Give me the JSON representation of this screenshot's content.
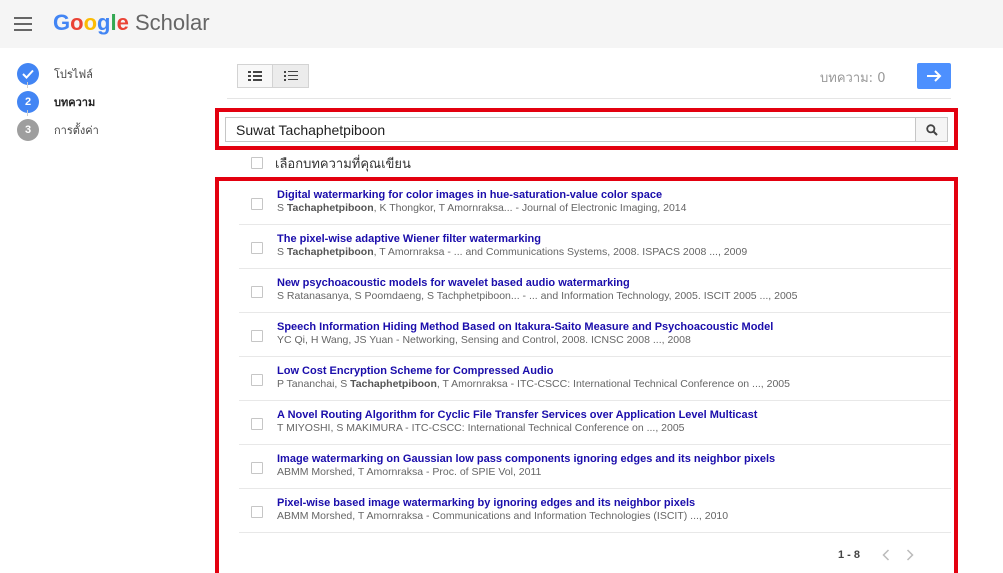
{
  "header": {
    "logo_letters": [
      "G",
      "o",
      "o",
      "g",
      "l",
      "e"
    ],
    "logo_suffix": "Scholar"
  },
  "steps": [
    {
      "number": "",
      "label": "โปรไฟล์",
      "state": "done"
    },
    {
      "number": "2",
      "label": "บทความ",
      "state": "current"
    },
    {
      "number": "3",
      "label": "การตั้งค่า",
      "state": "pending"
    }
  ],
  "toolbar": {
    "article_count_label": "บทความ: 0"
  },
  "search": {
    "value": "Suwat Tachaphetpiboon"
  },
  "select_all_label": "เลือกบทความที่คุณเขียน",
  "results": [
    {
      "title": "Digital watermarking for color images in hue-saturation-value color space",
      "authors_pre": "S ",
      "authors_bold": "Tachaphetpiboon",
      "authors_post": ", K Thongkor, T Amornraksa... - Journal of Electronic Imaging, 2014"
    },
    {
      "title": "The pixel-wise adaptive Wiener filter watermarking",
      "authors_pre": "S ",
      "authors_bold": "Tachaphetpiboon",
      "authors_post": ", T Amornraksa - ... and Communications Systems, 2008. ISPACS 2008 ..., 2009"
    },
    {
      "title": "New psychoacoustic models for wavelet based audio watermarking",
      "authors_pre": "S Ratanasanya, S Poomdaeng, S Tachphetpiboon... - ... and Information Technology, 2005. ISCIT 2005 ..., 2005",
      "authors_bold": "",
      "authors_post": ""
    },
    {
      "title": "Speech Information Hiding Method Based on Itakura-Saito Measure and Psychoacoustic Model",
      "authors_pre": "YC Qi, H Wang, JS Yuan - Networking, Sensing and Control, 2008. ICNSC 2008 ..., 2008",
      "authors_bold": "",
      "authors_post": ""
    },
    {
      "title": "Low Cost Encryption Scheme for Compressed Audio",
      "authors_pre": "P Tananchai, S ",
      "authors_bold": "Tachaphetpiboon",
      "authors_post": ", T Amornraksa - ITC-CSCC: International Technical Conference on ..., 2005"
    },
    {
      "title": "A Novel Routing Algorithm for Cyclic File Transfer Services over Application Level Multicast",
      "authors_pre": "T MIYOSHI, S MAKIMURA - ITC-CSCC: International Technical Conference on ..., 2005",
      "authors_bold": "",
      "authors_post": ""
    },
    {
      "title": "Image watermarking on Gaussian low pass components ignoring edges and its neighbor pixels",
      "authors_pre": "ABMM Morshed, T Amornraksa - Proc. of SPIE Vol, 2011",
      "authors_bold": "",
      "authors_post": ""
    },
    {
      "title": "Pixel-wise based image watermarking by ignoring edges and its neighbor pixels",
      "authors_pre": "ABMM Morshed, T Amornraksa - Communications and Information Technologies (ISCIT) ..., 2010",
      "authors_bold": "",
      "authors_post": ""
    }
  ],
  "pagination": {
    "range": "1 - 8"
  },
  "icons": {
    "menu": "hamburger-menu-icon",
    "next": "arrow-right-icon",
    "search": "magnifier-icon",
    "prev_page": "chevron-left-icon",
    "next_page": "chevron-right-icon",
    "done_step": "checkmark-icon"
  },
  "colors": {
    "accent_blue": "#4d90fe",
    "step_done": "#4285f4",
    "step_pending": "#9e9e9e",
    "highlight_red": "#e3000f",
    "result_title": "#1a0dab"
  }
}
